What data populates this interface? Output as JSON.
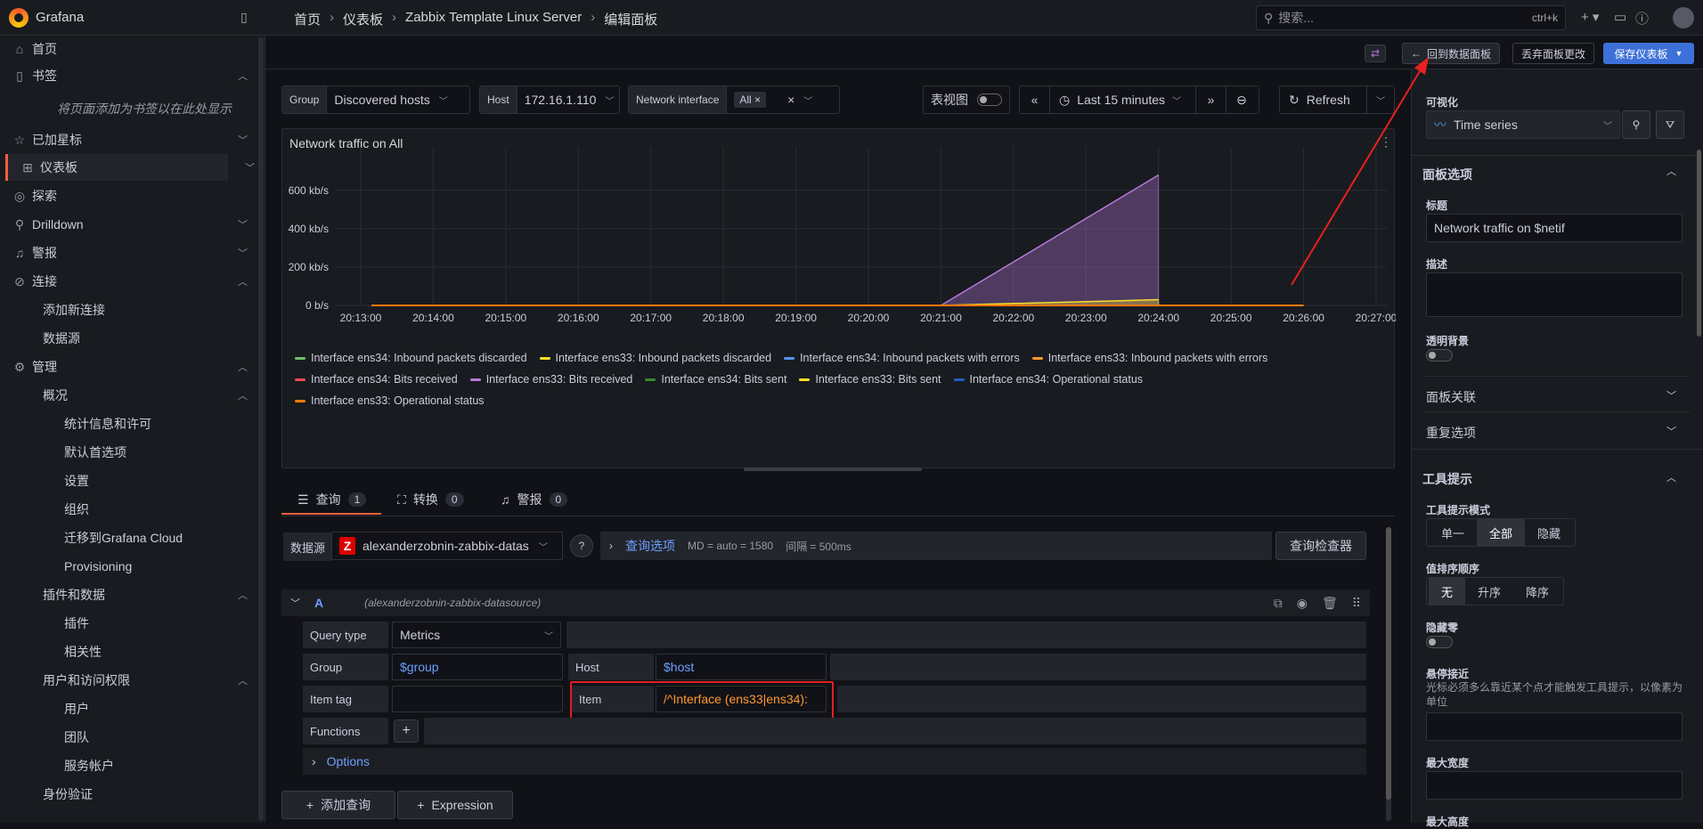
{
  "app": {
    "brand": "Grafana"
  },
  "breadcrumb": [
    "首页",
    "仪表板",
    "Zabbix Template Linux Server",
    "编辑面板"
  ],
  "search": {
    "placeholder": "搜索...",
    "shortcut": "ctrl+k"
  },
  "sidebar": {
    "bookmark_hint": "将页面添加为书签以在此处显示",
    "items": [
      {
        "label": "首页",
        "icon": "home-icon"
      },
      {
        "label": "书签",
        "icon": "bookmark-icon"
      },
      {
        "label": "已加星标",
        "icon": "star-icon"
      },
      {
        "label": "仪表板",
        "icon": "grid-icon"
      },
      {
        "label": "探索",
        "icon": "compass-icon"
      },
      {
        "label": "Drilldown",
        "icon": "drilldown-icon"
      },
      {
        "label": "警报",
        "icon": "bell-icon"
      },
      {
        "label": "连接",
        "icon": "link-icon"
      },
      {
        "label": "添加新连接"
      },
      {
        "label": "数据源"
      },
      {
        "label": "管理",
        "icon": "gear-icon"
      },
      {
        "label": "概况"
      },
      {
        "label": "统计信息和许可"
      },
      {
        "label": "默认首选项"
      },
      {
        "label": "设置"
      },
      {
        "label": "组织"
      },
      {
        "label": "迁移到Grafana Cloud"
      },
      {
        "label": "Provisioning"
      },
      {
        "label": "插件和数据"
      },
      {
        "label": "插件"
      },
      {
        "label": "相关性"
      },
      {
        "label": "用户和访问权限"
      },
      {
        "label": "用户"
      },
      {
        "label": "团队"
      },
      {
        "label": "服务帐户"
      },
      {
        "label": "身份验证"
      }
    ]
  },
  "actions": {
    "back": "回到数据面板",
    "discard": "丢弃面板更改",
    "save": "保存仪表板"
  },
  "variables": {
    "group_label": "Group",
    "group_value": "Discovered hosts",
    "host_label": "Host",
    "host_value": "172.16.1.110",
    "netif_label": "Network interface",
    "netif_value": "All"
  },
  "toolbar": {
    "table_view": "表视图",
    "time_range": "Last 15 minutes",
    "refresh": "Refresh"
  },
  "panel": {
    "title": "Network traffic on All"
  },
  "chart_data": {
    "type": "area",
    "title": "Network traffic on All",
    "x": [
      "20:13:00",
      "20:14:00",
      "20:15:00",
      "20:16:00",
      "20:17:00",
      "20:18:00",
      "20:19:00",
      "20:20:00",
      "20:21:00",
      "20:22:00",
      "20:23:00",
      "20:24:00",
      "20:25:00",
      "20:26:00",
      "20:27:00"
    ],
    "yticks": [
      "0 b/s",
      "200 kb/s",
      "400 kb/s",
      "600 kb/s"
    ],
    "ylim": [
      0,
      780
    ],
    "series": [
      {
        "name": "Interface ens33: Bits received",
        "color": "#b877d9",
        "points": [
          [
            8.0,
            0
          ],
          [
            11.0,
            680
          ]
        ]
      },
      {
        "name": "Interface ens33: Bits sent",
        "color": "#fade2a",
        "points": [
          [
            8.0,
            0
          ],
          [
            11.0,
            30
          ]
        ]
      },
      {
        "name": "Interface ens33: Operational status",
        "color": "#ff780a",
        "points": [
          [
            0,
            0
          ],
          [
            13.0,
            0
          ]
        ]
      }
    ],
    "legend": [
      {
        "name": "Interface ens34: Inbound packets discarded",
        "color": "#73bf69"
      },
      {
        "name": "Interface ens33: Inbound packets discarded",
        "color": "#fade2a"
      },
      {
        "name": "Interface ens34: Inbound packets with errors",
        "color": "#5794f2"
      },
      {
        "name": "Interface ens33: Inbound packets with errors",
        "color": "#ff9830"
      },
      {
        "name": "Interface ens34: Bits received",
        "color": "#f2495c"
      },
      {
        "name": "Interface ens33: Bits received",
        "color": "#b877d9"
      },
      {
        "name": "Interface ens34: Bits sent",
        "color": "#37872d"
      },
      {
        "name": "Interface ens33: Bits sent",
        "color": "#fade2a"
      },
      {
        "name": "Interface ens34: Operational status",
        "color": "#1f60c4"
      },
      {
        "name": "Interface ens33: Operational status",
        "color": "#ff780a"
      }
    ]
  },
  "tabs": [
    {
      "label": "查询",
      "count": "1"
    },
    {
      "label": "转换",
      "count": "0"
    },
    {
      "label": "警报",
      "count": "0"
    }
  ],
  "query": {
    "ds_label": "数据源",
    "ds_value": "alexanderzobnin-zabbix-datas",
    "options_label": "查询选项",
    "options_info": "MD = auto = 1580",
    "interval_info": "间隔 = 500ms",
    "inspector": "查询检查器",
    "ref": "A",
    "ref_ds": "(alexanderzobnin-zabbix-datasource)",
    "query_type_label": "Query type",
    "query_type": "Metrics",
    "group_label": "Group",
    "group_value": "$group",
    "host_label": "Host",
    "host_value": "$host",
    "item_tag_label": "Item tag",
    "item_label": "Item",
    "item_value": "/^Interface (ens33|ens34):",
    "functions_label": "Functions",
    "options": "Options",
    "add_query": "添加查询",
    "expression": "Expression"
  },
  "options_pane": {
    "viz_label": "可视化",
    "viz_value": "Time series",
    "panel_options": "面板选项",
    "title_label": "标题",
    "title_value": "Network traffic on $netif",
    "desc_label": "描述",
    "transparent": "透明背景",
    "panel_links": "面板关联",
    "repeat": "重复选项",
    "tooltip": "工具提示",
    "tooltip_mode": "工具提示模式",
    "mode_options": [
      "单一",
      "全部",
      "隐藏"
    ],
    "sort_label": "值排序顺序",
    "sort_options": [
      "无",
      "升序",
      "降序"
    ],
    "hide_zero": "隐藏零",
    "hover_label": "悬停接近",
    "hover_desc": "光标必须多么靠近某个点才能触发工具提示，以像素为单位",
    "max_width": "最大宽度",
    "max_height": "最大高度"
  }
}
